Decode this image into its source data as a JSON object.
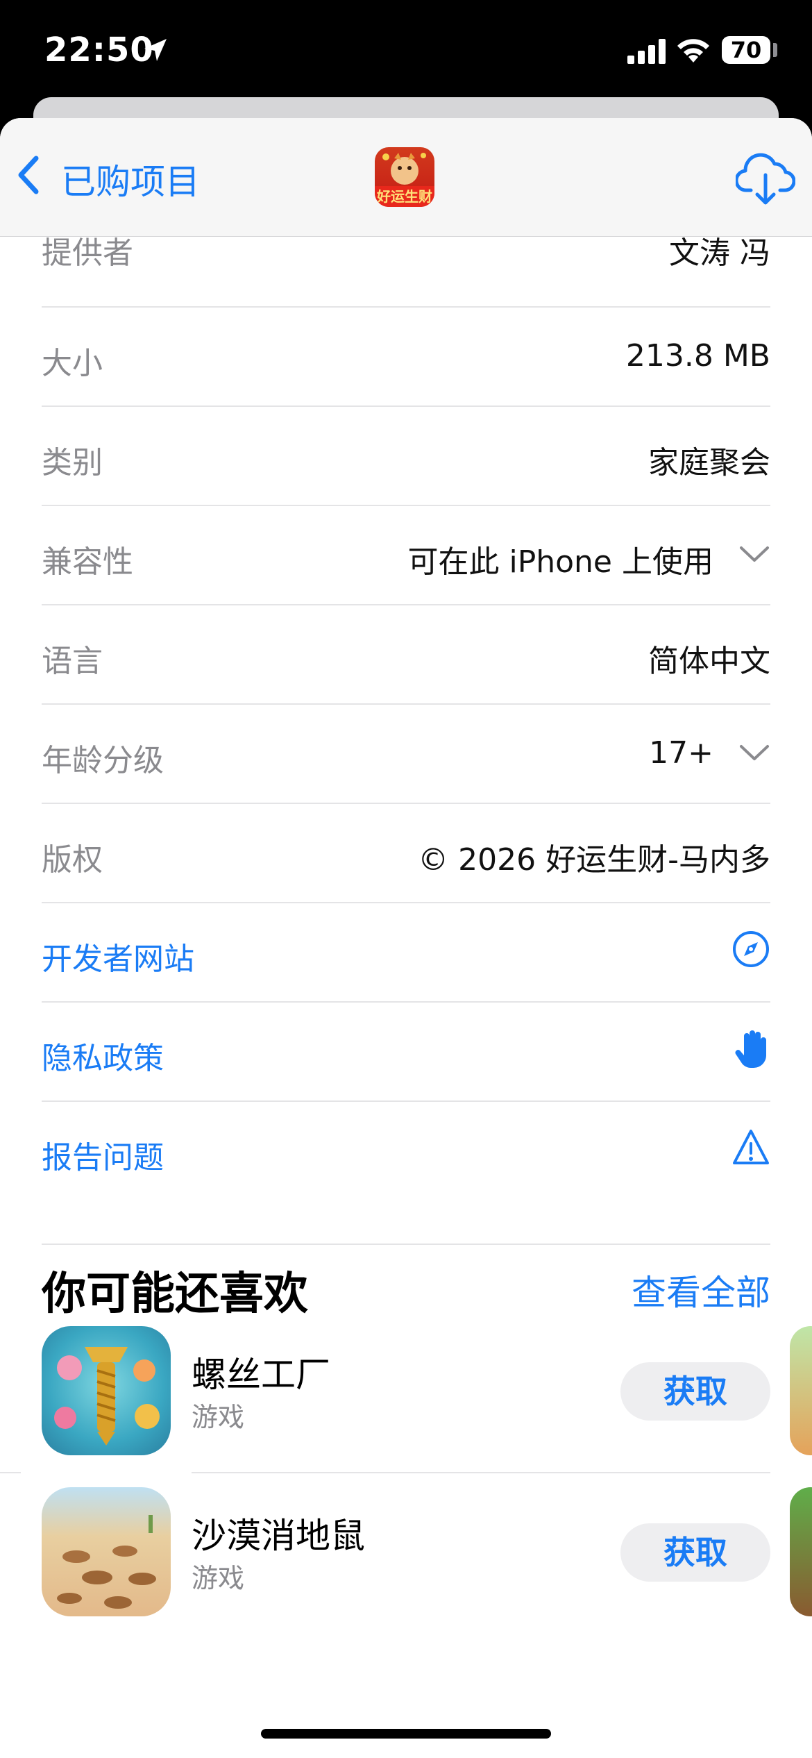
{
  "status_bar": {
    "time": "22:50",
    "battery": "70"
  },
  "nav": {
    "back_label": "已购项目",
    "app_icon_text": "好运生财"
  },
  "info_rows": [
    {
      "label": "提供者",
      "value": "文涛 冯"
    },
    {
      "label": "大小",
      "value": "213.8 MB"
    },
    {
      "label": "类别",
      "value": "家庭聚会"
    },
    {
      "label": "兼容性",
      "value": "可在此 iPhone 上使用"
    },
    {
      "label": "语言",
      "value": "简体中文"
    },
    {
      "label": "年龄分级",
      "value": "17+"
    },
    {
      "label": "版权",
      "value": "© 2026 好运生财-马内多"
    }
  ],
  "links": [
    {
      "label": "开发者网站",
      "icon": "compass-icon"
    },
    {
      "label": "隐私政策",
      "icon": "hand-icon"
    },
    {
      "label": "报告问题",
      "icon": "warning-icon"
    }
  ],
  "recommend": {
    "title": "你可能还喜欢",
    "see_all": "查看全部",
    "apps": [
      {
        "name": "螺丝工厂",
        "category": "游戏",
        "button": "获取"
      },
      {
        "name": "沙漠消地鼠",
        "category": "游戏",
        "button": "获取"
      }
    ]
  },
  "colors": {
    "accent": "#1a7cf5",
    "label_gray": "#8a8a8e"
  }
}
